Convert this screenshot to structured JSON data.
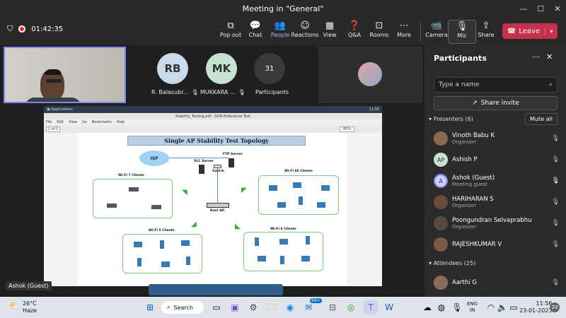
{
  "window": {
    "title": "Meeting in \"General\"",
    "minimize": "—",
    "maximize": "☐",
    "close": "✕"
  },
  "toolbar": {
    "timer": "01:42:35",
    "buttons": [
      {
        "label": "Pop out",
        "icon": "⧉"
      },
      {
        "label": "Chat",
        "icon": "💬"
      },
      {
        "label": "People",
        "icon": "👥"
      },
      {
        "label": "Reactions",
        "icon": "☺"
      },
      {
        "label": "View",
        "icon": "▦"
      },
      {
        "label": "Q&A",
        "icon": "❓"
      },
      {
        "label": "Rooms",
        "icon": "⊡"
      },
      {
        "label": "More",
        "icon": "⋯"
      },
      {
        "label": "Camera",
        "icon": "📹"
      },
      {
        "label": "Mic",
        "icon": "🎙"
      },
      {
        "label": "Share",
        "icon": "⇪"
      }
    ],
    "leave": "Leave"
  },
  "stage": {
    "tiles": [
      {
        "initials": "RB",
        "name": "R. Balasubr...",
        "color": "#c9dbea"
      },
      {
        "initials": "MK",
        "name": "MUKKARA ...",
        "color": "#c6e3d1"
      }
    ],
    "count": "31",
    "count_label": "Participants",
    "presenter_label": "Ashok (Guest)"
  },
  "shared_screen": {
    "file": "Stability_Testing.pdf - SON Endurance Test",
    "menu": [
      "File",
      "Edit",
      "View",
      "Go",
      "Bookmarks",
      "Help"
    ],
    "zoom": "85%",
    "page": "1 of 1",
    "clock": "11:56",
    "diagram": {
      "title": "Single AP Stability Test Topology",
      "isp": "ISP",
      "ftp": "FTP Server",
      "vlc": "VLC Server",
      "switch": "Switch",
      "root_ap": "Root AP",
      "wifi7": "Wi-Fi 7 Clients",
      "wifi6e": "Wi-Fi 6E Clients",
      "wifi5": "Wi-Fi 5 Clients",
      "wifi6": "Wi-Fi 6 Clients"
    }
  },
  "panel": {
    "title": "Participants",
    "search_placeholder": "Type a name",
    "share_invite": "Share invite",
    "presenters_label": "Presenters (6)",
    "mute_all": "Mute all",
    "attendees_label": "Attendees (25)",
    "presenters": [
      {
        "name": "Vinoth Babu K",
        "role": "Organizer",
        "initials": "",
        "color": "#8a6a50"
      },
      {
        "name": "Ashish P",
        "role": "",
        "initials": "AP",
        "color": "#c6e3d1"
      },
      {
        "name": "Ashok (Guest)",
        "role": "Meeting guest",
        "initials": "A",
        "color": "#c9d0ff"
      },
      {
        "name": "HARIHARAN S",
        "role": "Organizer",
        "initials": "",
        "color": "#6b4c3a"
      },
      {
        "name": "Poongundran Selvaprabhu",
        "role": "Organizer",
        "initials": "",
        "color": "#5a4a3e"
      },
      {
        "name": "RAJESHKUMAR V",
        "role": "",
        "initials": "",
        "color": "#7a5a44"
      }
    ],
    "attendees": [
      {
        "name": "Aarthi G",
        "role": "",
        "initials": "",
        "color": "#8c6d5c"
      }
    ]
  },
  "taskbar": {
    "weather_temp": "26°C",
    "weather_text": "Haze",
    "search": "Search",
    "lang1": "ENG",
    "lang2": "IN",
    "time": "11:56",
    "date": "23-01-2023",
    "badge": "99+",
    "notif": "20"
  }
}
